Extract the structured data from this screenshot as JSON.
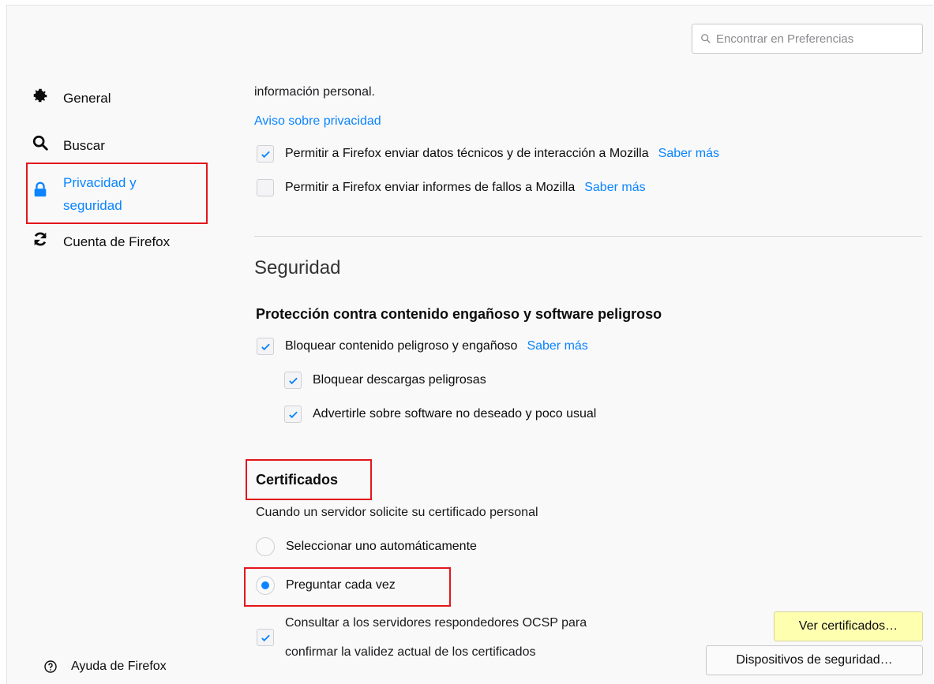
{
  "search": {
    "placeholder": "Encontrar en Preferencias"
  },
  "sidebar": {
    "items": [
      {
        "label": "General",
        "icon": "gear-icon"
      },
      {
        "label": "Buscar",
        "icon": "search-icon"
      },
      {
        "label": "Privacidad y seguridad",
        "line1": "Privacidad y",
        "line2": "seguridad",
        "icon": "lock-icon",
        "selected": true
      },
      {
        "label": "Cuenta de Firefox",
        "icon": "sync-icon"
      }
    ],
    "help": "Ayuda de Firefox"
  },
  "privacy": {
    "info_text": "información personal.",
    "notice_link": "Aviso sobre privacidad",
    "options": [
      {
        "label": "Permitir a Firefox enviar datos técnicos y de interacción a Mozilla",
        "checked": true,
        "link": "Saber más"
      },
      {
        "label": "Permitir a Firefox enviar informes de fallos a Mozilla",
        "checked": false,
        "link": "Saber más"
      }
    ]
  },
  "security": {
    "title": "Seguridad",
    "protection_heading": "Protección contra contenido engañoso y software peligroso",
    "block_dangerous": {
      "label": "Bloquear contenido peligroso y engañoso",
      "checked": true,
      "link": "Saber más"
    },
    "block_downloads": {
      "label": "Bloquear descargas peligrosas",
      "checked": true
    },
    "warn_unwanted": {
      "label": "Advertirle sobre software no deseado y poco usual",
      "checked": true
    }
  },
  "certificates": {
    "heading": "Certificados",
    "prompt": "Cuando un servidor solicite su certificado personal",
    "radio_auto": {
      "label": "Seleccionar uno automáticamente",
      "selected": false
    },
    "radio_ask": {
      "label": "Preguntar cada vez",
      "selected": true
    },
    "ocsp": {
      "line1": "Consultar a los servidores respondedores OCSP para",
      "line2": "confirmar la validez actual de los certificados",
      "checked": true
    },
    "view_button": "Ver certificados…",
    "devices_button": "Dispositivos de seguridad…"
  },
  "colors": {
    "accent": "#0a84ff",
    "highlight_box": "#e3161b",
    "button_highlight": "#ffffb0"
  }
}
